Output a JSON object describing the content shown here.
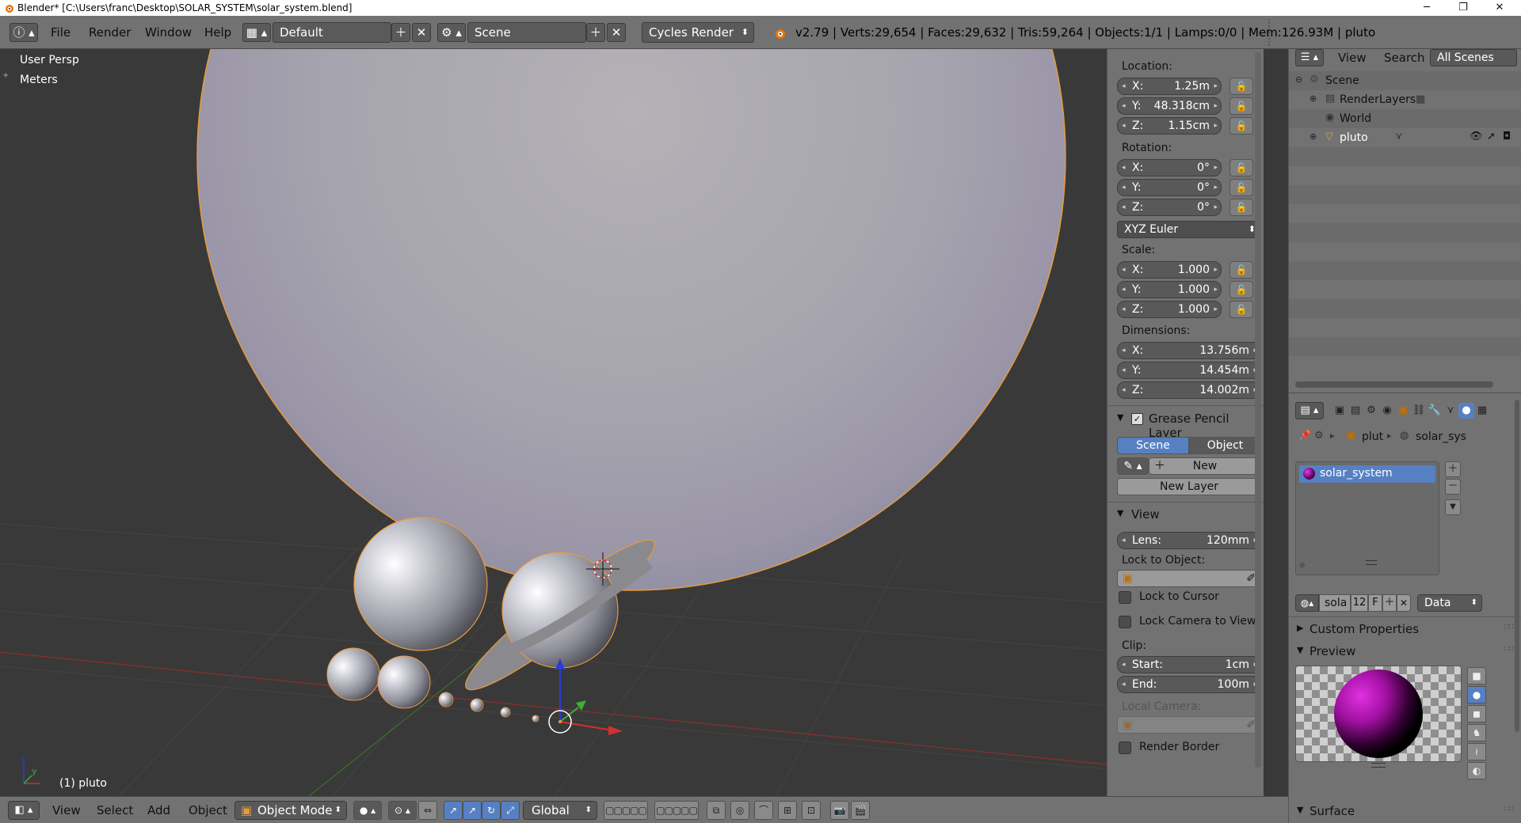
{
  "window": {
    "title": "Blender* [C:\\Users\\franc\\Desktop\\SOLAR_SYSTEM\\solar_system.blend]",
    "minimize": "─",
    "maximize": "❐",
    "close": "✕"
  },
  "info_header": {
    "menus": [
      "File",
      "Render",
      "Window",
      "Help"
    ],
    "screen_layout": "Default",
    "scene": "Scene",
    "render_engine": "Cycles Render",
    "stats": "v2.79 | Verts:29,654 | Faces:29,632 | Tris:59,264 | Objects:1/1 | Lamps:0/0 | Mem:126.93M | pluto"
  },
  "viewport": {
    "view_name": "User Persp",
    "units": "Meters",
    "active_object": "(1) pluto"
  },
  "npanel": {
    "location_label": "Location:",
    "location": [
      {
        "axis": "X:",
        "value": "1.25m"
      },
      {
        "axis": "Y:",
        "value": "48.318cm"
      },
      {
        "axis": "Z:",
        "value": "1.15cm"
      }
    ],
    "rotation_label": "Rotation:",
    "rotation": [
      {
        "axis": "X:",
        "value": "0°"
      },
      {
        "axis": "Y:",
        "value": "0°"
      },
      {
        "axis": "Z:",
        "value": "0°"
      }
    ],
    "rotation_mode": "XYZ Euler",
    "scale_label": "Scale:",
    "scale": [
      {
        "axis": "X:",
        "value": "1.000"
      },
      {
        "axis": "Y:",
        "value": "1.000"
      },
      {
        "axis": "Z:",
        "value": "1.000"
      }
    ],
    "dimensions_label": "Dimensions:",
    "dimensions": [
      {
        "axis": "X:",
        "value": "13.756m"
      },
      {
        "axis": "Y:",
        "value": "14.454m"
      },
      {
        "axis": "Z:",
        "value": "14.002m"
      }
    ],
    "grease_pencil_title": "Grease Pencil Layer",
    "gp_scene": "Scene",
    "gp_object": "Object",
    "gp_new": "New",
    "gp_new_layer": "New Layer",
    "view_title": "View",
    "lens_label": "Lens:",
    "lens_value": "120mm",
    "lock_to_object": "Lock to Object:",
    "lock_to_cursor": "Lock to Cursor",
    "lock_camera": "Lock Camera to View",
    "clip_label": "Clip:",
    "clip_start_label": "Start:",
    "clip_start": "1cm",
    "clip_end_label": "End:",
    "clip_end": "100m",
    "local_camera": "Local Camera:",
    "render_border": "Render Border"
  },
  "outliner": {
    "menus": [
      "View",
      "Search"
    ],
    "filter": "All Scenes",
    "tree": [
      {
        "label": "Scene"
      },
      {
        "label": "RenderLayers"
      },
      {
        "label": "World"
      },
      {
        "label": "pluto"
      }
    ]
  },
  "properties": {
    "breadcrumb_object": "plut",
    "breadcrumb_material": "solar_sys",
    "material_slot": "solar_system",
    "material_name": "sola",
    "users": "12",
    "fake_user": "F",
    "link": "Data",
    "custom_properties": "Custom Properties",
    "preview": "Preview",
    "surface": "Surface"
  },
  "bottom_bar": {
    "menus": [
      "View",
      "Select",
      "Add",
      "Object"
    ],
    "mode": "Object Mode",
    "orientation": "Global"
  },
  "colors": {
    "header_bg": "#727272",
    "viewport_bg": "#393939",
    "selected_blue": "#5680c2",
    "outline_orange": "#f0a040"
  }
}
